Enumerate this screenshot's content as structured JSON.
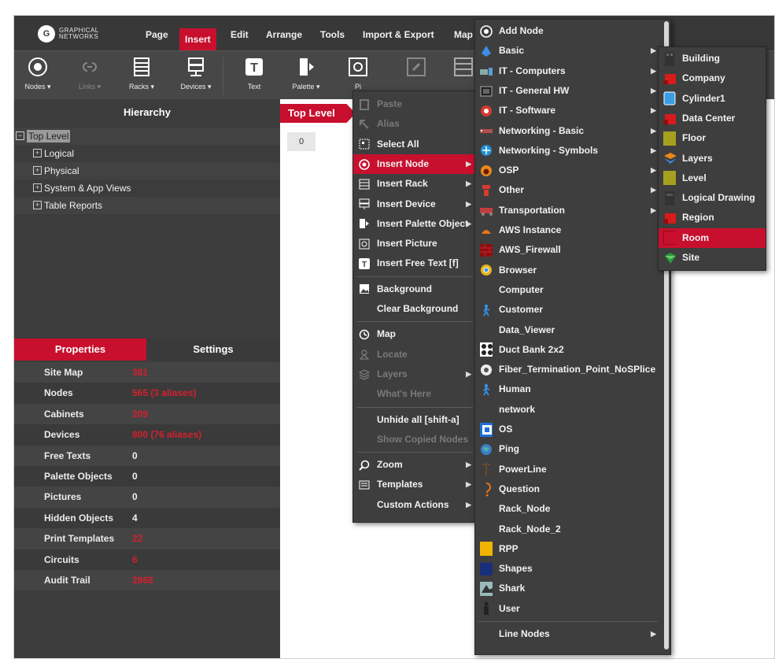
{
  "app": {
    "logo_mark": "G",
    "logo_text_1": "GRAPHICAL",
    "logo_text_2": "NETWORKS",
    "menu": [
      "Page",
      "Insert",
      "Edit",
      "Arrange",
      "Tools",
      "Import & Export",
      "Map"
    ]
  },
  "toolbar": {
    "nodes": "Nodes ▾",
    "links": "Links ▾",
    "racks": "Racks ▾",
    "devices": "Devices ▾",
    "text": "Text",
    "palette": "Palette ▾",
    "picture": "Pi"
  },
  "hierarchy": {
    "title": "Hierarchy",
    "top_level": "Top Level",
    "items": [
      "Logical",
      "Physical",
      "System & App Views",
      "Table Reports"
    ]
  },
  "tabs": {
    "properties": "Properties",
    "settings": "Settings"
  },
  "properties": [
    {
      "label": "Site Map",
      "value": "381",
      "color": "#d4202f"
    },
    {
      "label": "Nodes",
      "value": "565 (3 aliases)",
      "color": "#d4202f"
    },
    {
      "label": "Cabinets",
      "value": "209",
      "color": "#d4202f"
    },
    {
      "label": "Devices",
      "value": "800 (76 aliases)",
      "color": "#d4202f"
    },
    {
      "label": "Free Texts",
      "value": "0",
      "color": "#f0f0f0"
    },
    {
      "label": "Palette Objects",
      "value": "0",
      "color": "#f0f0f0"
    },
    {
      "label": "Pictures",
      "value": "0",
      "color": "#f0f0f0"
    },
    {
      "label": "Hidden Objects",
      "value": "4",
      "color": "#f0f0f0"
    },
    {
      "label": "Print Templates",
      "value": "22",
      "color": "#d4202f"
    },
    {
      "label": "Circuits",
      "value": "6",
      "color": "#d4202f"
    },
    {
      "label": "Audit Trail",
      "value": "2868",
      "color": "#d4202f"
    }
  ],
  "canvas": {
    "breadcrumb": "Top Level",
    "zoom_chip": "0"
  },
  "context_menu": [
    {
      "label": "Paste",
      "icon": "paste-icon",
      "disabled": true
    },
    {
      "label": "Alias",
      "icon": "alias-icon",
      "disabled": true
    },
    {
      "label": "Select All",
      "icon": "select-all-icon"
    },
    {
      "label": "Insert Node",
      "icon": "node-icon",
      "submenu": true,
      "highlighted": true
    },
    {
      "label": "Insert Rack",
      "icon": "rack-icon",
      "submenu": true
    },
    {
      "label": "Insert Device",
      "icon": "device-icon",
      "submenu": true
    },
    {
      "label": "Insert Palette Object",
      "icon": "palette-icon",
      "submenu": true
    },
    {
      "label": "Insert Picture",
      "icon": "picture-icon"
    },
    {
      "label": "Insert Free Text [f]",
      "icon": "text-icon"
    },
    {
      "label": "Background",
      "icon": "background-icon"
    },
    {
      "label": "Clear Background",
      "icon": ""
    },
    {
      "label": "Map",
      "icon": "map-icon"
    },
    {
      "label": "Locate",
      "icon": "locate-icon",
      "disabled": true
    },
    {
      "label": "Layers",
      "icon": "layers-icon",
      "disabled": true,
      "submenu": true
    },
    {
      "label": "What's Here",
      "icon": "",
      "disabled": true
    },
    {
      "label": "Unhide all [shift-a]",
      "icon": ""
    },
    {
      "label": "Show Copied Nodes",
      "icon": "",
      "disabled": true
    },
    {
      "label": "Zoom",
      "icon": "zoom-icon",
      "submenu": true
    },
    {
      "label": "Templates",
      "icon": "templates-icon",
      "submenu": true
    },
    {
      "label": "Custom Actions",
      "icon": "",
      "submenu": true
    }
  ],
  "node_menu": [
    {
      "label": "Add Node",
      "icon": "add-node-icon"
    },
    {
      "label": "Basic",
      "icon": "basic-icon",
      "submenu": true
    },
    {
      "label": "IT - Computers",
      "icon": "computers-icon",
      "submenu": true
    },
    {
      "label": "IT - General HW",
      "icon": "hardware-icon",
      "submenu": true
    },
    {
      "label": "IT - Software",
      "icon": "software-icon",
      "submenu": true
    },
    {
      "label": "Networking - Basic",
      "icon": "networking-icon",
      "submenu": true
    },
    {
      "label": "Networking - Symbols",
      "icon": "network-symbols-icon",
      "submenu": true
    },
    {
      "label": "OSP",
      "icon": "osp-icon",
      "submenu": true
    },
    {
      "label": "Other",
      "icon": "other-icon",
      "submenu": true
    },
    {
      "label": "Transportation",
      "icon": "transportation-icon",
      "submenu": true
    },
    {
      "label": "AWS Instance",
      "icon": "aws-instance-icon"
    },
    {
      "label": "AWS_Firewall",
      "icon": "firewall-icon"
    },
    {
      "label": "Browser",
      "icon": "browser-icon"
    },
    {
      "label": "Computer",
      "icon": ""
    },
    {
      "label": "Customer",
      "icon": "person-icon"
    },
    {
      "label": "Data_Viewer",
      "icon": ""
    },
    {
      "label": "Duct Bank 2x2",
      "icon": "duct-bank-icon"
    },
    {
      "label": "Fiber_Termination_Point_NoSPlice",
      "icon": "fiber-icon"
    },
    {
      "label": "Human",
      "icon": "person-icon"
    },
    {
      "label": "network",
      "icon": ""
    },
    {
      "label": "OS",
      "icon": "os-icon"
    },
    {
      "label": "Ping",
      "icon": "globe-icon"
    },
    {
      "label": "PowerLine",
      "icon": "powerline-icon"
    },
    {
      "label": "Question",
      "icon": "question-icon"
    },
    {
      "label": "Rack_Node",
      "icon": ""
    },
    {
      "label": "Rack_Node_2",
      "icon": ""
    },
    {
      "label": "RPP",
      "icon": "rpp-icon"
    },
    {
      "label": "Shapes",
      "icon": "shapes-icon"
    },
    {
      "label": "Shark",
      "icon": "shark-icon"
    },
    {
      "label": "User",
      "icon": "user-icon"
    },
    {
      "label": "Line Nodes",
      "icon": "",
      "submenu": true
    }
  ],
  "basic_menu": [
    {
      "label": "Building",
      "icon": "building-icon"
    },
    {
      "label": "Company",
      "icon": "company-icon"
    },
    {
      "label": "Cylinder1",
      "icon": "cylinder-icon"
    },
    {
      "label": "Data Center",
      "icon": "data-center-icon"
    },
    {
      "label": "Floor",
      "icon": "floor-icon"
    },
    {
      "label": "Layers",
      "icon": "layers-icon"
    },
    {
      "label": "Level",
      "icon": "level-icon"
    },
    {
      "label": "Logical Drawing",
      "icon": "logical-drawing-icon"
    },
    {
      "label": "Region",
      "icon": "region-icon"
    },
    {
      "label": "Room",
      "icon": "room-icon",
      "highlighted": true
    },
    {
      "label": "Site",
      "icon": "site-icon"
    }
  ],
  "colors": {
    "accent": "#c8102e",
    "panel": "#3c3c3c",
    "topbar": "#383838"
  }
}
